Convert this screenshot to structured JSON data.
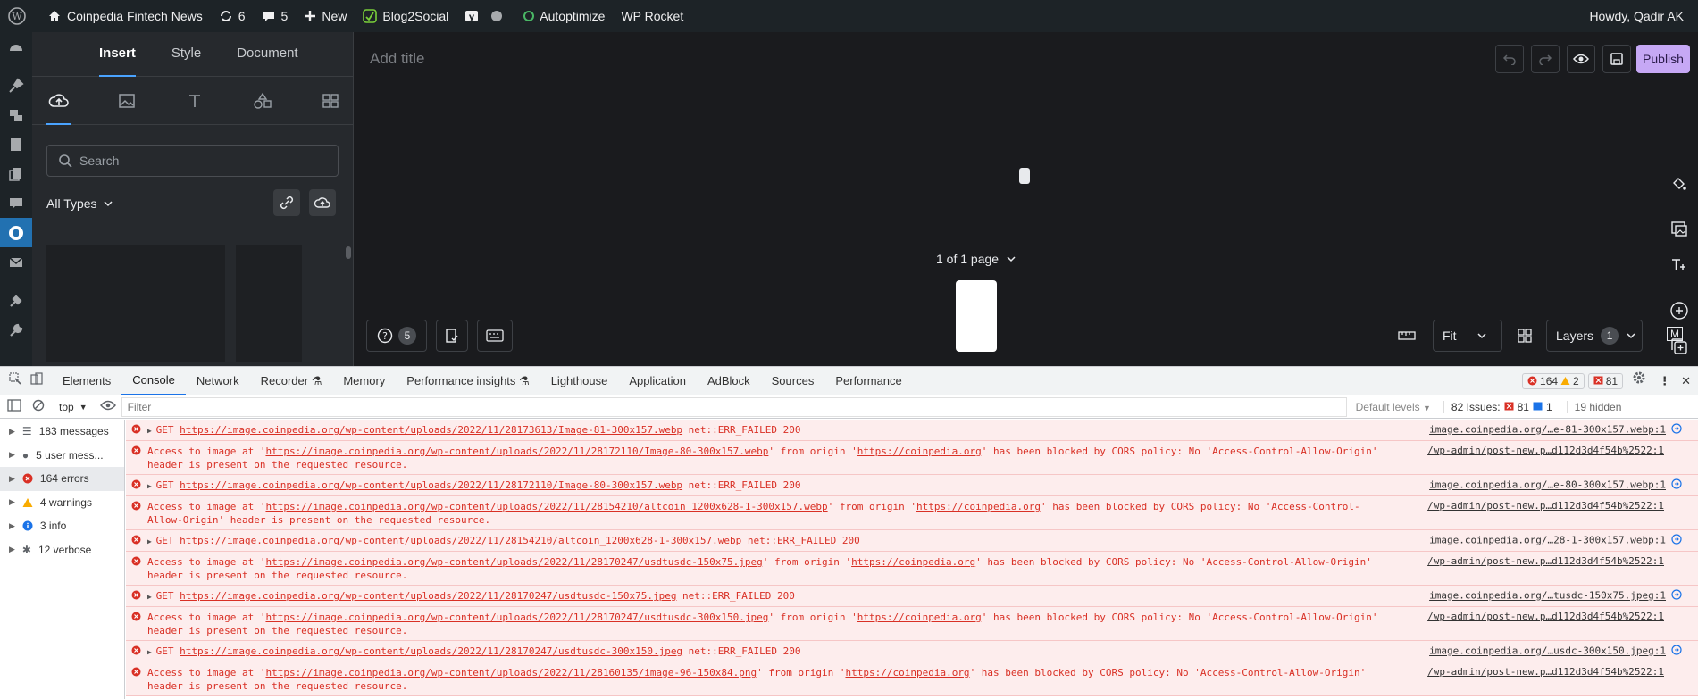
{
  "adminbar": {
    "site": "Coinpedia Fintech News",
    "updates": "6",
    "comments": "5",
    "new": "New",
    "blog2social": "Blog2Social",
    "autoptimize": "Autoptimize",
    "wprocket": "WP Rocket",
    "howdy": "Howdy, Qadir AK"
  },
  "panel": {
    "tabs": [
      "Insert",
      "Style",
      "Document"
    ],
    "search_placeholder": "Search",
    "all_types": "All Types"
  },
  "canvas": {
    "add_title": "Add title",
    "publish": "Publish",
    "page_info": "1 of 1 page",
    "help_count": "5",
    "fit": "Fit",
    "layers": "Layers",
    "layers_count": "1",
    "corner": "M"
  },
  "devtools": {
    "tabs": [
      "Elements",
      "Console",
      "Network",
      "Recorder",
      "Memory",
      "Performance insights",
      "Lighthouse",
      "Application",
      "AdBlock",
      "Sources",
      "Performance"
    ],
    "counts": {
      "errors": "164",
      "warnings": "2",
      "issues": "81"
    },
    "context": "top",
    "filter_placeholder": "Filter",
    "default_levels": "Default levels",
    "issues_label": "82 Issues:",
    "issues_err": "81",
    "issues_info": "1",
    "hidden": "19 hidden",
    "sidebar": [
      "183 messages",
      "5 user mess...",
      "164 errors",
      "4 warnings",
      "3 info",
      "12 verbose"
    ],
    "log": [
      {
        "type": "get",
        "url": "https://image.coinpedia.org/wp-content/uploads/2022/11/28173613/Image-81-300x157.webp",
        "suffix": "net::ERR_FAILED 200",
        "src": "image.coinpedia.org/…e-81-300x157.webp:1"
      },
      {
        "type": "cors",
        "url": "https://image.coinpedia.org/wp-content/uploads/2022/11/28172110/Image-80-300x157.webp",
        "origin": "https://coinpedia.org",
        "src": "/wp-admin/post-new.p…d112d3d4f54b%2522:1"
      },
      {
        "type": "get",
        "url": "https://image.coinpedia.org/wp-content/uploads/2022/11/28172110/Image-80-300x157.webp",
        "suffix": "net::ERR_FAILED 200",
        "src": "image.coinpedia.org/…e-80-300x157.webp:1"
      },
      {
        "type": "cors",
        "url": "https://image.coinpedia.org/wp-content/uploads/2022/11/28154210/altcoin_1200x628-1-300x157.webp",
        "origin": "https://coinpedia.org",
        "src": "/wp-admin/post-new.p…d112d3d4f54b%2522:1"
      },
      {
        "type": "get",
        "url": "https://image.coinpedia.org/wp-content/uploads/2022/11/28154210/altcoin_1200x628-1-300x157.webp",
        "suffix": "net::ERR_FAILED 200",
        "src": "image.coinpedia.org/…28-1-300x157.webp:1"
      },
      {
        "type": "cors",
        "url": "https://image.coinpedia.org/wp-content/uploads/2022/11/28170247/usdtusdc-150x75.jpeg",
        "origin": "https://coinpedia.org",
        "src": "/wp-admin/post-new.p…d112d3d4f54b%2522:1"
      },
      {
        "type": "get",
        "url": "https://image.coinpedia.org/wp-content/uploads/2022/11/28170247/usdtusdc-150x75.jpeg",
        "suffix": "net::ERR_FAILED 200",
        "src": "image.coinpedia.org/…tusdc-150x75.jpeg:1"
      },
      {
        "type": "cors",
        "url": "https://image.coinpedia.org/wp-content/uploads/2022/11/28170247/usdtusdc-300x150.jpeg",
        "origin": "https://coinpedia.org",
        "src": "/wp-admin/post-new.p…d112d3d4f54b%2522:1"
      },
      {
        "type": "get",
        "url": "https://image.coinpedia.org/wp-content/uploads/2022/11/28170247/usdtusdc-300x150.jpeg",
        "suffix": "net::ERR_FAILED 200",
        "src": "image.coinpedia.org/…usdc-300x150.jpeg:1"
      },
      {
        "type": "cors",
        "url": "https://image.coinpedia.org/wp-content/uploads/2022/11/28160135/image-96-150x84.png",
        "origin": "https://coinpedia.org",
        "src": "/wp-admin/post-new.p…d112d3d4f54b%2522:1"
      }
    ],
    "cors_prefix": "Access to image at '",
    "cors_mid": "' from origin '",
    "cors_suffix": "' has been blocked by CORS policy: No 'Access-Control-Allow-Origin' header is present on the requested resource.",
    "get_prefix": "GET"
  },
  "colors": {
    "accent": "#2271b1",
    "publish": "#c6a8f5",
    "error": "#d93025",
    "error_bg": "#fdeded"
  }
}
